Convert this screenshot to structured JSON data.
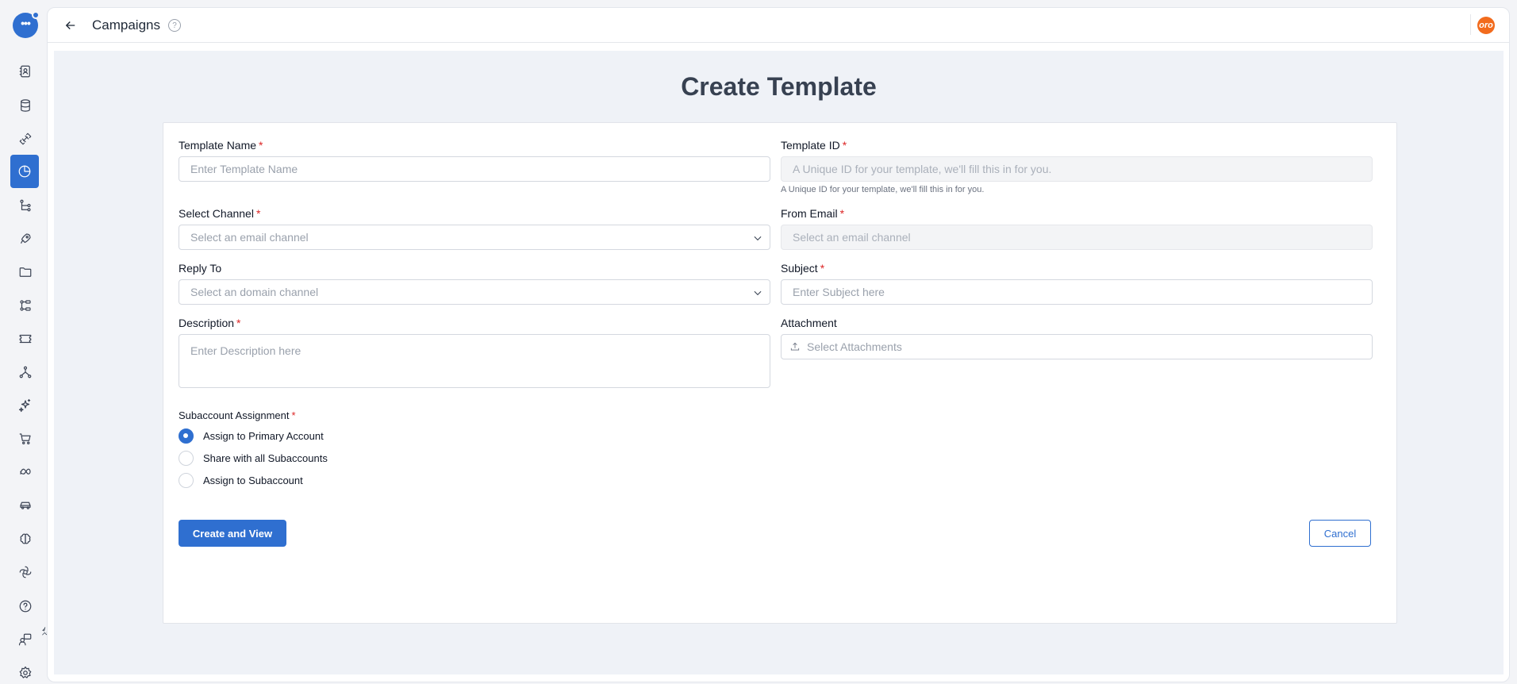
{
  "header": {
    "title": "Campaigns",
    "help_glyph": "?",
    "avatar_text": "oro"
  },
  "page": {
    "heading": "Create Template"
  },
  "form": {
    "template_name": {
      "label": "Template Name",
      "required": "*",
      "placeholder": "Enter Template Name"
    },
    "template_id": {
      "label": "Template ID",
      "required": "*",
      "placeholder": "A Unique ID for your template, we'll fill this in for you.",
      "hint": "A Unique ID for your template, we'll fill this in for you."
    },
    "select_channel": {
      "label": "Select Channel",
      "required": "*",
      "placeholder": "Select an email channel"
    },
    "from_email": {
      "label": "From Email",
      "required": "*",
      "placeholder": "Select an email channel"
    },
    "reply_to": {
      "label": "Reply To",
      "placeholder": "Select an domain channel"
    },
    "subject": {
      "label": "Subject",
      "required": "*",
      "placeholder": "Enter Subject here"
    },
    "description": {
      "label": "Description",
      "required": "*",
      "placeholder": "Enter Description here"
    },
    "attachment": {
      "label": "Attachment",
      "placeholder": "Select Attachments"
    },
    "subaccount": {
      "label": "Subaccount Assignment",
      "required": "*",
      "options": [
        {
          "label": "Assign to Primary Account",
          "checked": true
        },
        {
          "label": "Share with all Subaccounts",
          "checked": false
        },
        {
          "label": "Assign to Subaccount",
          "checked": false
        }
      ]
    }
  },
  "actions": {
    "create_label": "Create and View",
    "cancel_label": "Cancel"
  },
  "sidebar": {
    "items": [
      {
        "icon": "contacts-icon"
      },
      {
        "icon": "database-icon"
      },
      {
        "icon": "integrations-icon"
      },
      {
        "icon": "campaigns-icon",
        "active": true
      },
      {
        "icon": "workflow-icon"
      },
      {
        "icon": "rocket-icon"
      },
      {
        "icon": "folder-icon"
      },
      {
        "icon": "automation-icon"
      },
      {
        "icon": "ticket-icon"
      },
      {
        "icon": "network-icon"
      },
      {
        "icon": "sparkles-icon"
      },
      {
        "icon": "cart-icon"
      },
      {
        "icon": "meta-icon"
      },
      {
        "icon": "car-icon"
      },
      {
        "icon": "brain-icon"
      },
      {
        "icon": "openai-icon"
      },
      {
        "icon": "help-icon"
      },
      {
        "icon": "support-icon"
      },
      {
        "icon": "settings-icon"
      }
    ]
  },
  "colors": {
    "accent": "#2f6fd0",
    "required": "#dc2626",
    "avatar": "#f26b1d"
  }
}
